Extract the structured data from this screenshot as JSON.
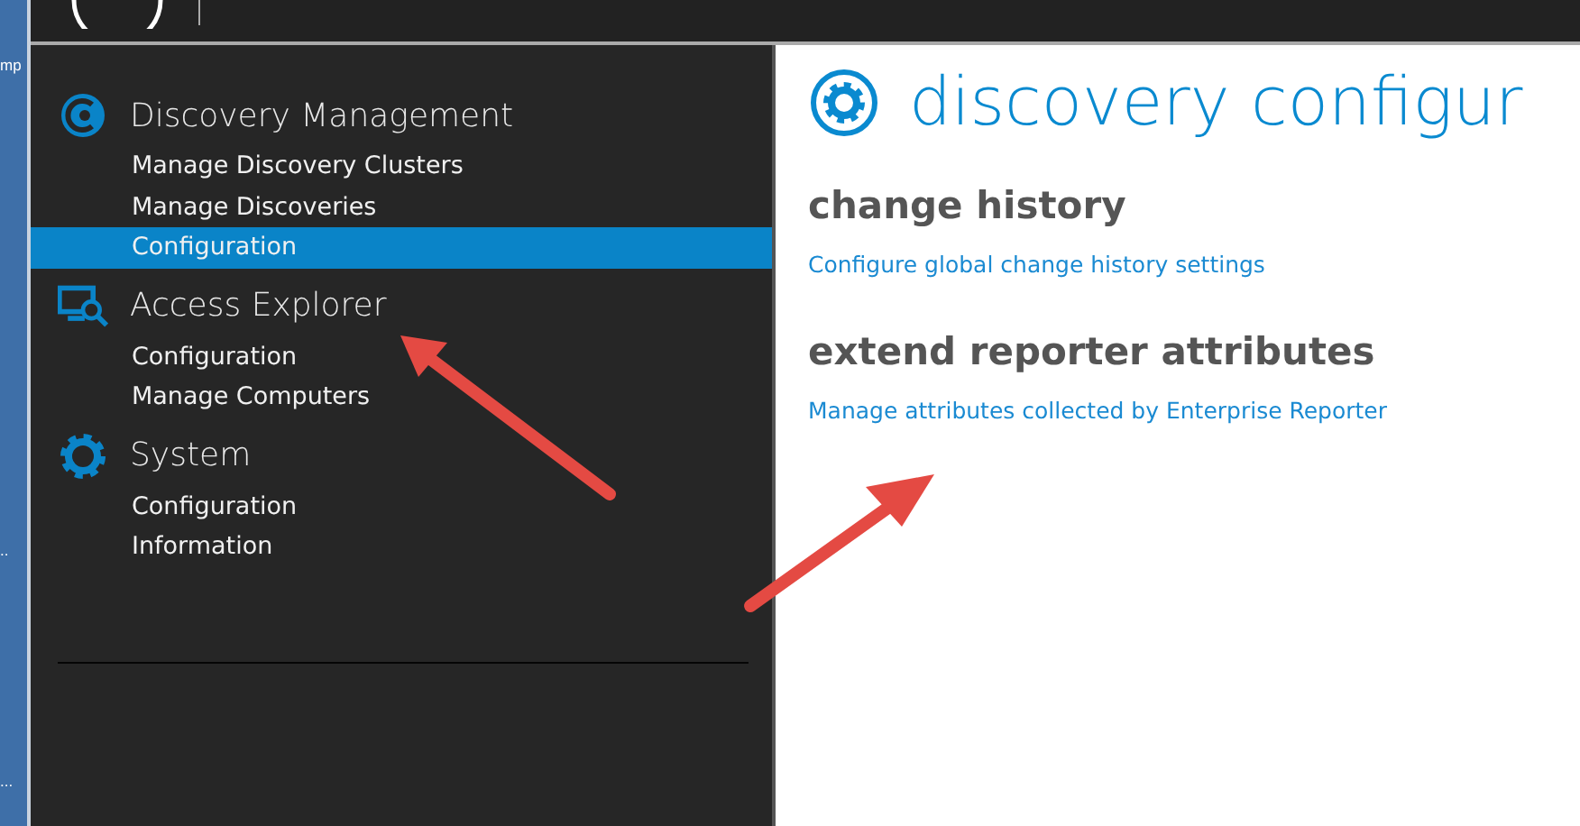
{
  "left_strip": {
    "texts": [
      "mp",
      "..",
      "..."
    ]
  },
  "sidebar": {
    "groups": [
      {
        "kind": "discovery",
        "title": "Discovery Management",
        "items": [
          {
            "label": "Manage Discovery Clusters",
            "selected": false
          },
          {
            "label": "Manage Discoveries",
            "selected": false
          },
          {
            "label": "Configuration",
            "selected": true
          }
        ]
      },
      {
        "kind": "explorer",
        "title": "Access Explorer",
        "items": [
          {
            "label": "Configuration",
            "selected": false
          },
          {
            "label": "Manage Computers",
            "selected": false
          }
        ]
      },
      {
        "kind": "system",
        "title": "System",
        "items": [
          {
            "label": "Configuration",
            "selected": false
          },
          {
            "label": "Information",
            "selected": false
          }
        ]
      }
    ]
  },
  "page": {
    "title": "discovery configur",
    "sections": [
      {
        "heading": "change history",
        "link": "Configure global change history settings"
      },
      {
        "heading": "extend reporter attributes",
        "link": "Manage attributes collected by Enterprise Reporter"
      }
    ]
  }
}
